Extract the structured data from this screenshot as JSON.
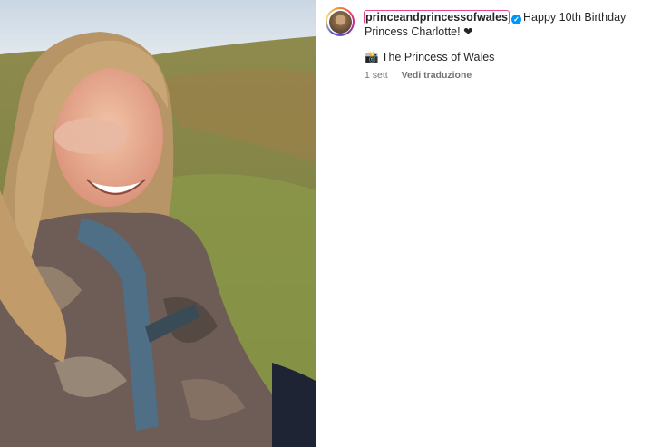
{
  "post": {
    "username": "princeandprincessofwales",
    "verified_mark": "✓",
    "caption_text": "Happy 10th Birthday Princess Charlotte! ❤",
    "credit": "📸 The Princess of Wales",
    "time": "1 sett",
    "translate_label": "Vedi traduzione"
  },
  "colors": {
    "verified_badge": "#0095f6",
    "username_highlight": "#e8478b"
  },
  "icons": {
    "avatar": "profile-avatar",
    "verified": "verified-badge-icon",
    "camera": "camera-emoji"
  }
}
